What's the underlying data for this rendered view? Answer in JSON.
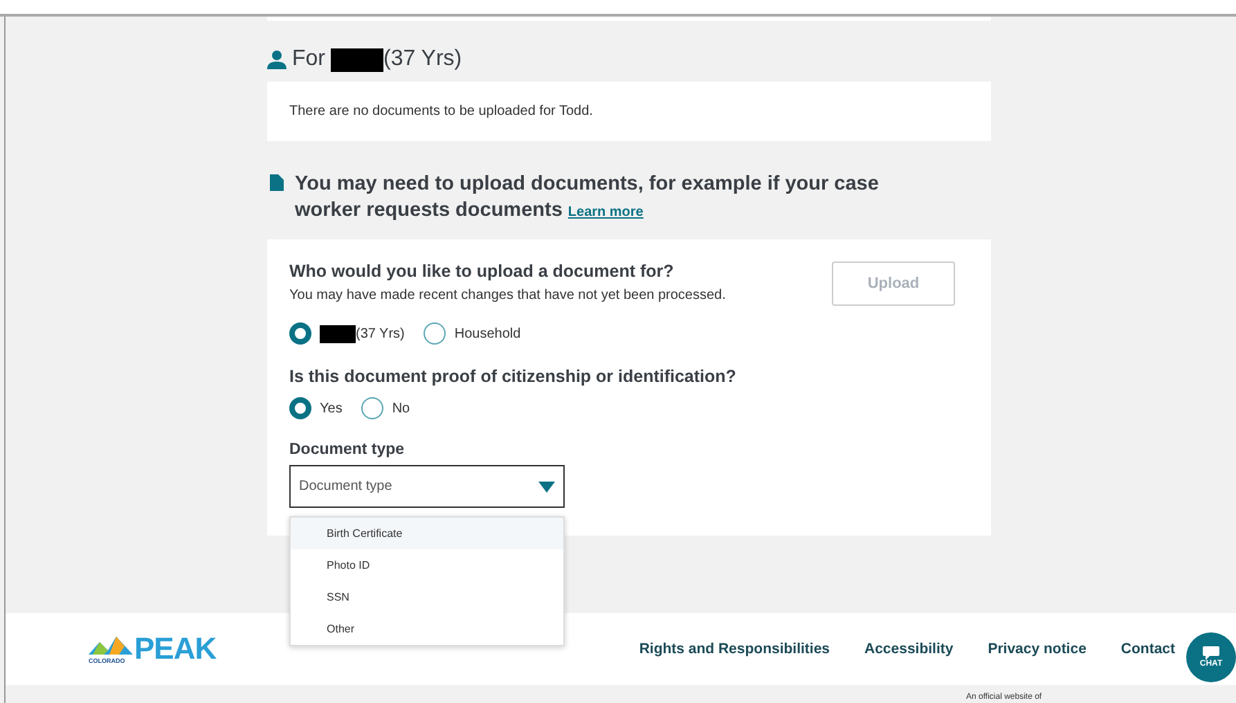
{
  "person_section": {
    "prefix": "For",
    "suffix": "(37 Yrs)",
    "message": "There are no documents to be uploaded for Todd."
  },
  "upload_notice": {
    "text": "You may need to upload documents, for example if your case worker requests documents",
    "link": "Learn more"
  },
  "upload_form": {
    "question": "Who would you like to upload a document for?",
    "hint": "You may have made recent changes that have not yet been processed.",
    "upload_button": {
      "label": "Upload",
      "disabled": true
    },
    "person_options": [
      {
        "kind": "redacted",
        "label": "(37 Yrs)",
        "selected": true
      },
      {
        "kind": "plain",
        "label": "Household",
        "selected": false
      }
    ],
    "proof_question": "Is this document proof of citizenship or identification?",
    "proof_options": [
      {
        "label": "Yes",
        "selected": true
      },
      {
        "label": "No",
        "selected": false
      }
    ],
    "document_type": {
      "label": "Document type",
      "placeholder": "Document type",
      "expanded": true,
      "options": [
        {
          "label": "Birth Certificate",
          "highlighted": true
        },
        {
          "label": "Photo ID",
          "highlighted": false
        },
        {
          "label": "SSN",
          "highlighted": false
        },
        {
          "label": "Other",
          "highlighted": false
        }
      ]
    }
  },
  "footer": {
    "logo": {
      "small": "COLORADO",
      "big": "PEAK"
    },
    "links": [
      "Rights and Responsibilities",
      "Accessibility",
      "Privacy notice",
      "Contact"
    ],
    "chat": "CHAT",
    "official": "An official website of"
  }
}
